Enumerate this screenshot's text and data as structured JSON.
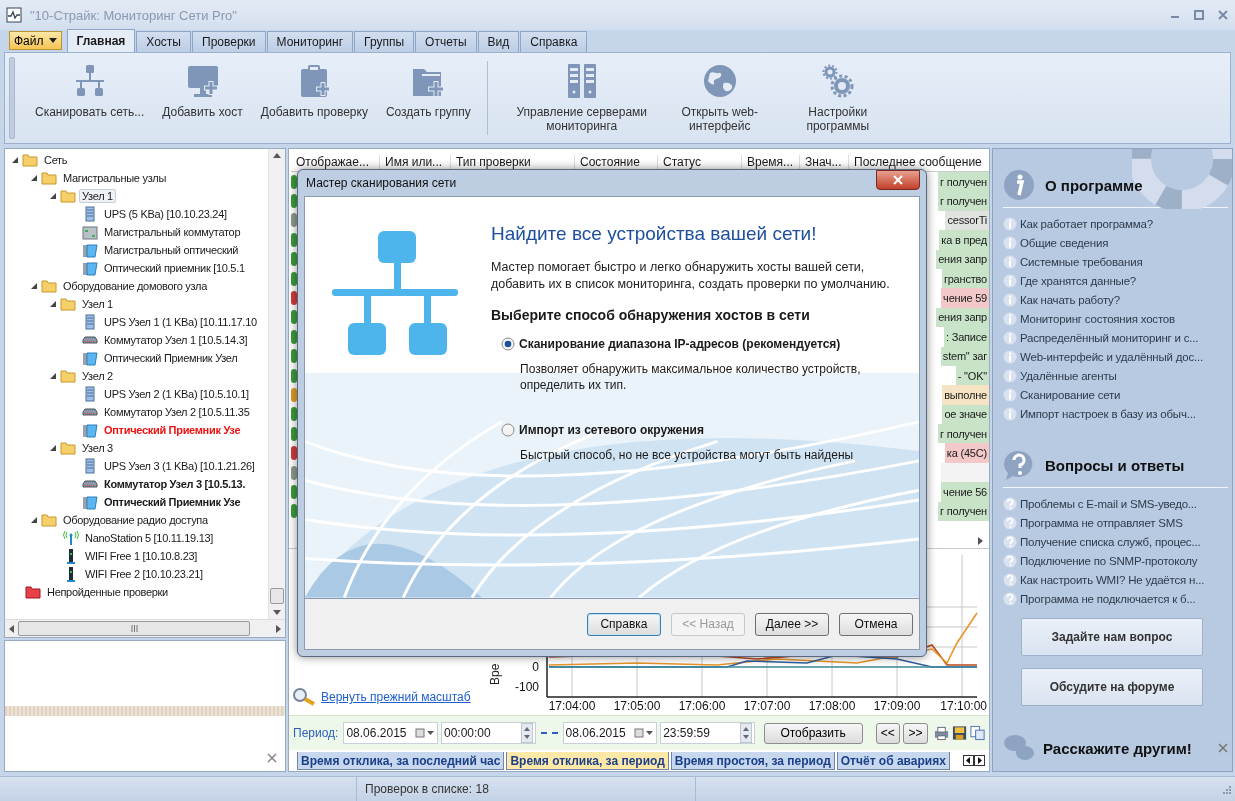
{
  "window": {
    "title": "\"10-Страйк: Мониторинг Сети Pro\""
  },
  "file_menu": {
    "label": "Файл"
  },
  "tabs": [
    {
      "label": "Главная",
      "selected": true
    },
    {
      "label": "Хосты",
      "selected": false
    },
    {
      "label": "Проверки",
      "selected": false
    },
    {
      "label": "Мониторинг",
      "selected": false
    },
    {
      "label": "Группы",
      "selected": false
    },
    {
      "label": "Отчеты",
      "selected": false
    },
    {
      "label": "Вид",
      "selected": false
    },
    {
      "label": "Справка",
      "selected": false
    }
  ],
  "ribbon_groups": [
    [
      {
        "label": "Сканировать сеть...",
        "kind": "network"
      },
      {
        "label": "Добавить хост",
        "kind": "add-host"
      },
      {
        "label": "Добавить проверку",
        "kind": "add-check"
      },
      {
        "label": "Создать группу",
        "kind": "add-group"
      }
    ],
    [
      {
        "label": "Управление серверами мониторинга",
        "kind": "servers"
      },
      {
        "label": "Открыть web-интерфейс",
        "kind": "globe"
      },
      {
        "label": "Настройки программы",
        "kind": "gears"
      }
    ]
  ],
  "tree": [
    {
      "label": "Сеть",
      "kind": "folder",
      "expanded": true,
      "selected": false,
      "children": [
        {
          "label": "Магистральные узлы",
          "kind": "folder",
          "expanded": true,
          "selected": false,
          "children": [
            {
              "label": "Узел 1",
              "kind": "folder",
              "expanded": true,
              "selected": true,
              "children": [
                {
                  "label": "UPS (5 KBa) [10.10.23.24]",
                  "kind": "ups",
                  "selected": false
                },
                {
                  "label": "Магистральный коммутатор",
                  "kind": "rack",
                  "selected": false
                },
                {
                  "label": "Магистральный оптический",
                  "kind": "optic",
                  "selected": false
                },
                {
                  "label": "Оптический приемник [10.5.1",
                  "kind": "optic",
                  "selected": false
                }
              ]
            }
          ]
        },
        {
          "label": "Оборудование домового узла",
          "kind": "folder",
          "expanded": true,
          "selected": false,
          "children": [
            {
              "label": "Узел 1",
              "kind": "folder",
              "expanded": true,
              "selected": false,
              "children": [
                {
                  "label": "UPS Узел 1 (1 KBa) [10.11.17.10",
                  "kind": "ups",
                  "selected": false
                },
                {
                  "label": "Коммутатор Узел 1 [10.5.14.3]",
                  "kind": "switch",
                  "selected": false
                },
                {
                  "label": "Оптический Приемник Узел",
                  "kind": "optic",
                  "selected": false
                }
              ]
            },
            {
              "label": "Узел 2",
              "kind": "folder",
              "expanded": true,
              "selected": false,
              "children": [
                {
                  "label": "UPS Узел 2 (1 KBa) [10.5.10.1]",
                  "kind": "ups",
                  "selected": false
                },
                {
                  "label": "Коммутатор Узел 2 [10.5.11.35",
                  "kind": "switch",
                  "selected": false
                },
                {
                  "label": "Оптический Приемник Узе",
                  "kind": "optic",
                  "selected": false,
                  "alert": true
                }
              ]
            },
            {
              "label": "Узел 3",
              "kind": "folder",
              "expanded": true,
              "selected": false,
              "children": [
                {
                  "label": "UPS Узел 3 (1 KBa) [10.1.21.26]",
                  "kind": "ups",
                  "selected": false
                },
                {
                  "label": "Коммутатор Узел 3 [10.5.13.",
                  "kind": "switch",
                  "selected": false,
                  "bold": true
                },
                {
                  "label": "Оптический Приемник Узе",
                  "kind": "optic",
                  "selected": false,
                  "bold": true
                }
              ]
            }
          ]
        },
        {
          "label": "Оборудование радио доступа",
          "kind": "folder",
          "expanded": true,
          "selected": false,
          "children": [
            {
              "label": "NanoStation 5 [10.11.19.13]",
              "kind": "antenna",
              "selected": false
            },
            {
              "label": "WIFI Free 1 [10.10.8.23]",
              "kind": "wifi",
              "selected": false
            },
            {
              "label": "WIFI Free 2 [10.10.23.21]",
              "kind": "wifi",
              "selected": false
            }
          ]
        }
      ]
    },
    {
      "label": "Непройденные проверки",
      "kind": "failed-folder",
      "selected": false
    }
  ],
  "table": {
    "columns": [
      "Отображае...",
      "Имя или...",
      "Тип проверки",
      "Состояние",
      "Статус",
      "Время...",
      "Знач...",
      "Последнее сообщение"
    ],
    "rows": [
      {
        "color": "#3c9a3c",
        "message": "г получен"
      },
      {
        "color": "#3c9a3c",
        "message": "г получен"
      },
      {
        "color": "#8f9a8f",
        "message": "cessorTi"
      },
      {
        "color": "#3c9a3c",
        "message": "ка в пред"
      },
      {
        "color": "#3c9a3c",
        "message": "ения запр"
      },
      {
        "color": "#3c9a3c",
        "message": "гранство"
      },
      {
        "color": "#d23a3a",
        "message": "чение 59"
      },
      {
        "color": "#3c9a3c",
        "message": "ения запр"
      },
      {
        "color": "#3c9a3c",
        "message": ": Записе"
      },
      {
        "color": "#3c9a3c",
        "message": "stem\" заг"
      },
      {
        "color": "#3c9a3c",
        "message": "- \"OK\""
      },
      {
        "color": "#e09a28",
        "message": "выполне"
      },
      {
        "color": "#3c9a3c",
        "message": "ое значе"
      },
      {
        "color": "#3c9a3c",
        "message": "г получен"
      },
      {
        "color": "#d23a3a",
        "message": "ка (45С)"
      },
      {
        "color": "#8f9a8f"
      },
      {
        "color": "#3c9a3c",
        "message": "чение 56"
      },
      {
        "color": "#3c9a3c",
        "message": "г получен"
      }
    ]
  },
  "chart": {
    "ylabel": "Вре",
    "yticks": [
      "0",
      "-100"
    ],
    "xticks": [
      "17:04:00",
      "17:05:00",
      "17:06:00",
      "17:07:00",
      "17:08:00",
      "17:09:00",
      "17:10:00"
    ]
  },
  "zoom_link": "Вернуть прежний масштаб",
  "period": {
    "label": "Период:",
    "from_date": "08.06.2015",
    "from_time": "00:00:00",
    "to_date": "08.06.2015",
    "to_time": "23:59:59",
    "show_button": "Отобразить",
    "prev_button": "<<",
    "next_button": ">>"
  },
  "report_tabs": [
    {
      "label": "Время отклика, за последний час",
      "selected": false
    },
    {
      "label": "Время отклика, за период",
      "selected": true
    },
    {
      "label": "Время простоя, за период",
      "selected": false
    },
    {
      "label": "Отчёт об авариях",
      "selected": false
    }
  ],
  "help_panel": {
    "about": {
      "title": "О программе",
      "items": [
        "Как работает программа?",
        "Общие сведения",
        "Системные требования",
        "Где хранятся данные?",
        "Как начать работу?",
        "Мониторинг состояния хостов",
        "Распределённый мониторинг и с...",
        "Web-интерфейс и удалённый дос...",
        "Удалённые агенты",
        "Сканирование сети",
        "Импорт настроек в базу из обыч..."
      ]
    },
    "faq": {
      "title": "Вопросы и ответы",
      "items": [
        "Проблемы с E-mail и SMS-уведо...",
        "Программа не отправляет SMS",
        "Получение списка служб, процес...",
        "Подключение по SNMP-протоколу",
        "Как настроить WMI? Не удаётся н...",
        "Программа не подключается к б..."
      ]
    },
    "buttons": [
      "Задайте нам вопрос",
      "Обсудите на форуме"
    ],
    "share": "Расскажите другим!"
  },
  "dialog": {
    "title": "Мастер сканирования сети",
    "heading": "Найдите все устройства вашей сети!",
    "intro": "Мастер помогает быстро и легко обнаружить хосты вашей сети, добавить их в список мониторинга, создать проверки по умолчанию.",
    "subheading": "Выберите способ обнаружения хостов в сети",
    "options": [
      {
        "label": "Сканирование диапазона IP-адресов (рекомендуется)",
        "description": "Позволяет обнаружить максимальное количество устройств, определить их тип.",
        "selected": true
      },
      {
        "label": "Импорт из сетевого окружения",
        "description": "Быстрый способ, но не все устройства могут быть найдены",
        "selected": false
      }
    ],
    "buttons": [
      {
        "label": "Справка",
        "disabled": false,
        "default": true
      },
      {
        "label": "<< Назад",
        "disabled": true,
        "default": false
      },
      {
        "label": "Далее >>",
        "disabled": false,
        "default": false
      },
      {
        "label": "Отмена",
        "disabled": false,
        "default": false
      }
    ]
  },
  "status_bar": {
    "text": "Проверок в списке: 18"
  }
}
